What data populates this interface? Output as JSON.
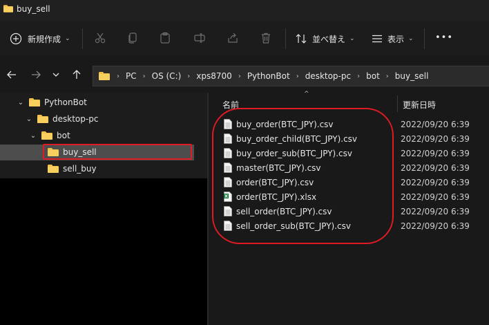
{
  "window": {
    "title": "buy_sell"
  },
  "toolbar": {
    "new_label": "新規作成",
    "sort_label": "並べ替え",
    "view_label": "表示",
    "more_label": "•••"
  },
  "breadcrumb": [
    "PC",
    "OS (C:)",
    "xps8700",
    "PythonBot",
    "desktop-pc",
    "bot",
    "buy_sell"
  ],
  "nav_tree": [
    {
      "label": "PythonBot"
    },
    {
      "label": "desktop-pc"
    },
    {
      "label": "bot"
    },
    {
      "label": "buy_sell",
      "selected": true
    },
    {
      "label": "sell_buy"
    }
  ],
  "columns": {
    "name": "名前",
    "date": "更新日時"
  },
  "files": [
    {
      "name": "buy_order(BTC_JPY).csv",
      "date": "2022/09/20 6:39",
      "type": "csv"
    },
    {
      "name": "buy_order_child(BTC_JPY).csv",
      "date": "2022/09/20 6:39",
      "type": "csv"
    },
    {
      "name": "buy_order_sub(BTC_JPY).csv",
      "date": "2022/09/20 6:39",
      "type": "csv"
    },
    {
      "name": "master(BTC_JPY).csv",
      "date": "2022/09/20 6:39",
      "type": "csv"
    },
    {
      "name": "order(BTC_JPY).csv",
      "date": "2022/09/20 6:39",
      "type": "csv"
    },
    {
      "name": "order(BTC_JPY).xlsx",
      "date": "2022/09/20 6:39",
      "type": "xlsx"
    },
    {
      "name": "sell_order(BTC_JPY).csv",
      "date": "2022/09/20 6:39",
      "type": "csv"
    },
    {
      "name": "sell_order_sub(BTC_JPY).csv",
      "date": "2022/09/20 6:39",
      "type": "csv"
    }
  ],
  "colors": {
    "folder": "#f3c14a",
    "annotation": "#e01b24",
    "selected": "#4d4d4d"
  }
}
